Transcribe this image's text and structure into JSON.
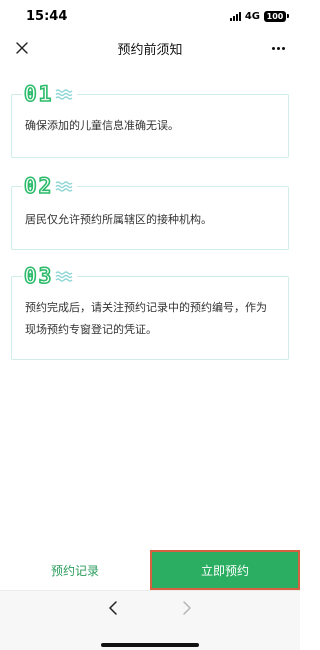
{
  "status_bar": {
    "time": "15:44",
    "network": "4G",
    "battery": "100"
  },
  "nav": {
    "title": "预约前须知",
    "close_icon": "close-icon",
    "more_icon": "more-icon"
  },
  "notices": [
    {
      "number": "01",
      "text": "确保添加的儿童信息准确无误。"
    },
    {
      "number": "02",
      "text": "居民仅允许预约所属辖区的接种机构。"
    },
    {
      "number": "03",
      "text": "预约完成后，请关注预约记录中的预约编号，作为现场预约专窗登记的凭证。"
    }
  ],
  "actions": {
    "records_label": "预约记录",
    "book_label": "立即预约"
  },
  "colors": {
    "accent_green": "#2bae61",
    "card_border": "#cfeee9",
    "wave": "#8fd6d6",
    "highlight_border": "#d6603f"
  }
}
